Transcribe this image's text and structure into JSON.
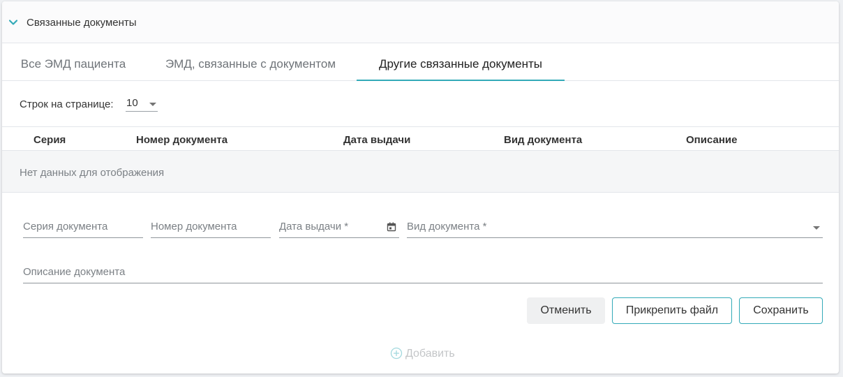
{
  "section": {
    "title": "Связанные документы"
  },
  "tabs": [
    {
      "label": "Все ЭМД пациента"
    },
    {
      "label": "ЭМД, связанные с документом"
    },
    {
      "label": "Другие связанные документы",
      "active": true
    }
  ],
  "pagination": {
    "rows_label": "Строк на странице:",
    "rows_value": "10"
  },
  "table": {
    "columns": [
      "Серия",
      "Номер документа",
      "Дата выдачи",
      "Вид документа",
      "Описание"
    ],
    "empty_text": "Нет данных для отображения"
  },
  "form": {
    "series_label": "Серия документа",
    "number_label": "Номер документа",
    "date_label": "Дата выдачи *",
    "type_label": "Вид документа *",
    "description_label": "Описание документа"
  },
  "buttons": {
    "cancel": "Отменить",
    "attach": "Прикрепить файл",
    "save": "Сохранить",
    "add": "Добавить"
  },
  "colors": {
    "accent": "#33aab8",
    "text": "#333333",
    "muted": "#7b8085",
    "cancel_bg": "#eff0f1"
  },
  "icons": {
    "collapse": "chevron-down-icon",
    "calendar": "calendar-icon",
    "add": "plus-circle-icon"
  }
}
